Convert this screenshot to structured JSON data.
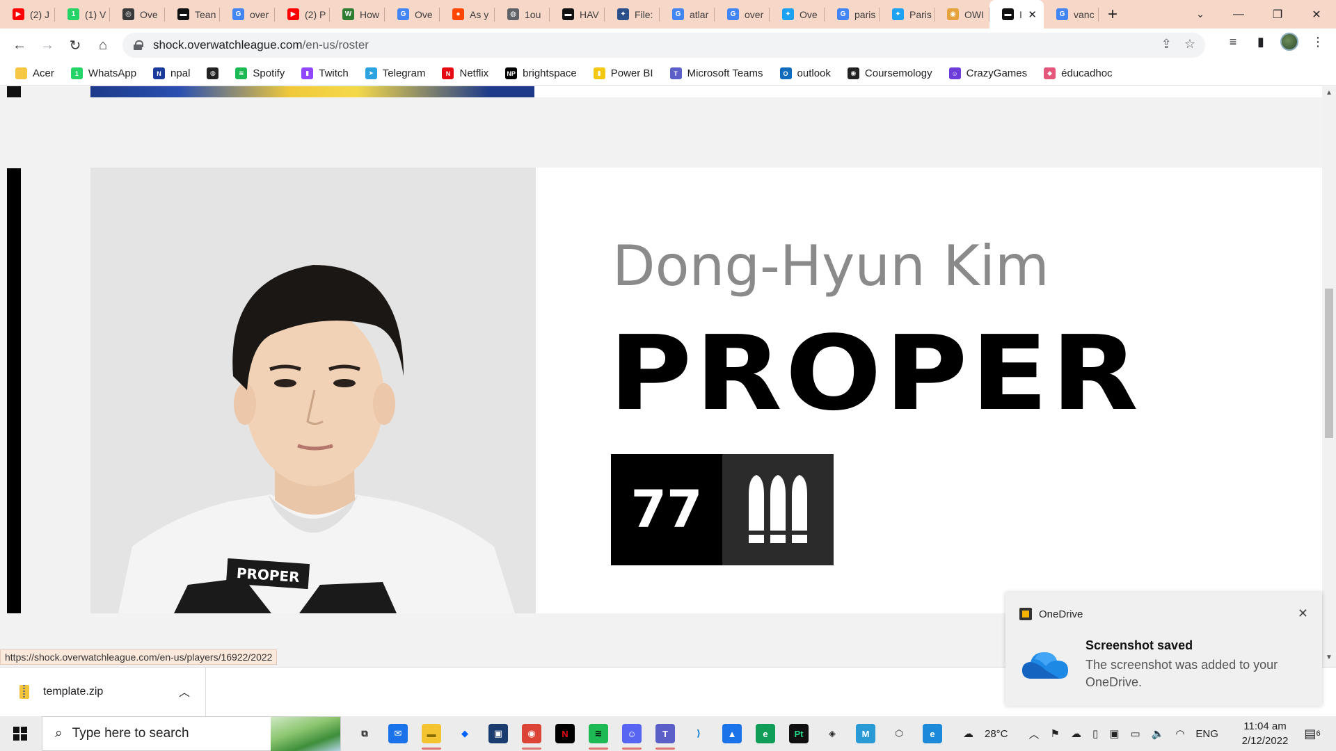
{
  "browser": {
    "tabs": [
      {
        "title": "(2) J",
        "icon": "youtube-icon",
        "color": "#ff0000",
        "glyph": "▶"
      },
      {
        "title": "(1) V",
        "icon": "whatsapp-icon",
        "color": "#25d366",
        "glyph": "1"
      },
      {
        "title": "Ove",
        "icon": "overwatch-icon",
        "color": "#3a3a3a",
        "glyph": "◎"
      },
      {
        "title": "Tean",
        "icon": "team-flag-icon",
        "color": "#111111",
        "glyph": "▬"
      },
      {
        "title": "over",
        "icon": "google-icon",
        "color": "#4285f4",
        "glyph": "G"
      },
      {
        "title": "(2) P",
        "icon": "youtube-icon",
        "color": "#ff0000",
        "glyph": "▶"
      },
      {
        "title": "How",
        "icon": "wikihow-icon",
        "color": "#2e7d32",
        "glyph": "W"
      },
      {
        "title": "Ove",
        "icon": "google-icon",
        "color": "#4285f4",
        "glyph": "G"
      },
      {
        "title": "As y",
        "icon": "reddit-icon",
        "color": "#ff4500",
        "glyph": "●"
      },
      {
        "title": "1ou",
        "icon": "globe-icon",
        "color": "#5f6368",
        "glyph": "◍"
      },
      {
        "title": "HAV",
        "icon": "team-flag-icon",
        "color": "#111111",
        "glyph": "▬"
      },
      {
        "title": "File:",
        "icon": "file-icon",
        "color": "#2b4f8a",
        "glyph": "✦"
      },
      {
        "title": "atlar",
        "icon": "google-icon",
        "color": "#4285f4",
        "glyph": "G"
      },
      {
        "title": "over",
        "icon": "google-icon",
        "color": "#4285f4",
        "glyph": "G"
      },
      {
        "title": "Ove",
        "icon": "twitter-icon",
        "color": "#1da1f2",
        "glyph": "✦"
      },
      {
        "title": "paris",
        "icon": "google-icon",
        "color": "#4285f4",
        "glyph": "G"
      },
      {
        "title": "Paris",
        "icon": "twitter-icon",
        "color": "#1da1f2",
        "glyph": "✦"
      },
      {
        "title": "OWI",
        "icon": "owl-icon",
        "color": "#e6a23c",
        "glyph": "◉"
      },
      {
        "title": "I",
        "icon": "team-flag-icon",
        "color": "#111111",
        "glyph": "▬",
        "active": true
      },
      {
        "title": "vanc",
        "icon": "google-icon",
        "color": "#4285f4",
        "glyph": "G"
      }
    ],
    "address": {
      "host": "shock.overwatchleague.com",
      "path": "/en-us/roster"
    },
    "bookmarks": [
      {
        "label": "Acer",
        "icon": "folder-icon",
        "color": "#f6c744",
        "glyph": ""
      },
      {
        "label": "WhatsApp",
        "icon": "whatsapp-icon",
        "color": "#25d366",
        "glyph": "1"
      },
      {
        "label": "npal",
        "icon": "npal-icon",
        "color": "#1a3a9c",
        "glyph": "N"
      },
      {
        "label": "",
        "icon": "globe-icon",
        "color": "#222222",
        "glyph": "◍"
      },
      {
        "label": "Spotify",
        "icon": "spotify-icon",
        "color": "#1db954",
        "glyph": "≋"
      },
      {
        "label": "Twitch",
        "icon": "twitch-icon",
        "color": "#9146ff",
        "glyph": "▮"
      },
      {
        "label": "Telegram",
        "icon": "telegram-icon",
        "color": "#2aa3e0",
        "glyph": "➤"
      },
      {
        "label": "Netflix",
        "icon": "netflix-icon",
        "color": "#e50914",
        "glyph": "N"
      },
      {
        "label": "brightspace",
        "icon": "np-icon",
        "color": "#000000",
        "glyph": "NP"
      },
      {
        "label": "Power BI",
        "icon": "powerbi-icon",
        "color": "#f2c811",
        "glyph": "▮"
      },
      {
        "label": "Microsoft Teams",
        "icon": "teams-icon",
        "color": "#5b5fc7",
        "glyph": "T"
      },
      {
        "label": "outlook",
        "icon": "outlook-icon",
        "color": "#0f6cbd",
        "glyph": "O"
      },
      {
        "label": "Coursemology",
        "icon": "coursemology-icon",
        "color": "#222222",
        "glyph": "◉"
      },
      {
        "label": "CrazyGames",
        "icon": "crazygames-icon",
        "color": "#6c3bd8",
        "glyph": "☺"
      },
      {
        "label": "éducadhoc",
        "icon": "educadhoc-icon",
        "color": "#e4577a",
        "glyph": "◆"
      }
    ]
  },
  "player": {
    "real_name": "Dong-Hyun Kim",
    "handle": "PROPER",
    "number": "77",
    "role_icon": "damage-role-icon",
    "jersey_text": "PROPER"
  },
  "status_url": "https://shock.overwatchleague.com/en-us/players/16922/2022",
  "toast": {
    "app": "OneDrive",
    "title": "Screenshot saved",
    "body": "The screenshot was added to your OneDrive."
  },
  "downloads": {
    "file": "template.zip"
  },
  "taskbar": {
    "search_placeholder": "Type here to search",
    "apps": [
      {
        "icon": "task-view-icon",
        "color": "#ececec",
        "glyph": "⧉",
        "fg": "#222"
      },
      {
        "icon": "mail-icon",
        "color": "#1a73e8",
        "glyph": "✉",
        "fg": "#fff"
      },
      {
        "icon": "file-explorer-icon",
        "color": "#f4c430",
        "glyph": "▬",
        "fg": "#8a6d00",
        "running": true
      },
      {
        "icon": "dropbox-icon",
        "color": "#ececec",
        "glyph": "◆",
        "fg": "#0061ff"
      },
      {
        "icon": "store-icon",
        "color": "#1b3c6e",
        "glyph": "▣",
        "fg": "#fff"
      },
      {
        "icon": "chrome-icon",
        "color": "#db4437",
        "glyph": "◉",
        "fg": "#fff",
        "running": true
      },
      {
        "icon": "netflix-icon",
        "color": "#000000",
        "glyph": "N",
        "fg": "#e50914"
      },
      {
        "icon": "spotify-icon",
        "color": "#1db954",
        "glyph": "≋",
        "fg": "#000",
        "running": true
      },
      {
        "icon": "discord-icon",
        "color": "#5865f2",
        "glyph": "☺",
        "fg": "#fff",
        "running": true
      },
      {
        "icon": "teams-icon",
        "color": "#5b5fc7",
        "glyph": "T",
        "fg": "#fff",
        "running": true
      },
      {
        "icon": "vscode-icon",
        "color": "#ececec",
        "glyph": "⟩",
        "fg": "#0078d4"
      },
      {
        "icon": "photos-icon",
        "color": "#1a73e8",
        "glyph": "▲",
        "fg": "#fff"
      },
      {
        "icon": "edge-icon",
        "color": "#0f9d58",
        "glyph": "e",
        "fg": "#fff"
      },
      {
        "icon": "pycharm-icon",
        "color": "#111111",
        "glyph": "Pt",
        "fg": "#21d789"
      },
      {
        "icon": "unity-icon",
        "color": "#ececec",
        "glyph": "◈",
        "fg": "#222"
      },
      {
        "icon": "maya-icon",
        "color": "#2a9ad6",
        "glyph": "M",
        "fg": "#fff"
      },
      {
        "icon": "unity-hub-icon",
        "color": "#ececec",
        "glyph": "⬡",
        "fg": "#222"
      },
      {
        "icon": "edge-dev-icon",
        "color": "#1c8ad8",
        "glyph": "e",
        "fg": "#fff"
      }
    ],
    "weather": "28°C",
    "language": "ENG",
    "time": "11:04 am",
    "date": "2/12/2022",
    "notification_count": "6"
  }
}
